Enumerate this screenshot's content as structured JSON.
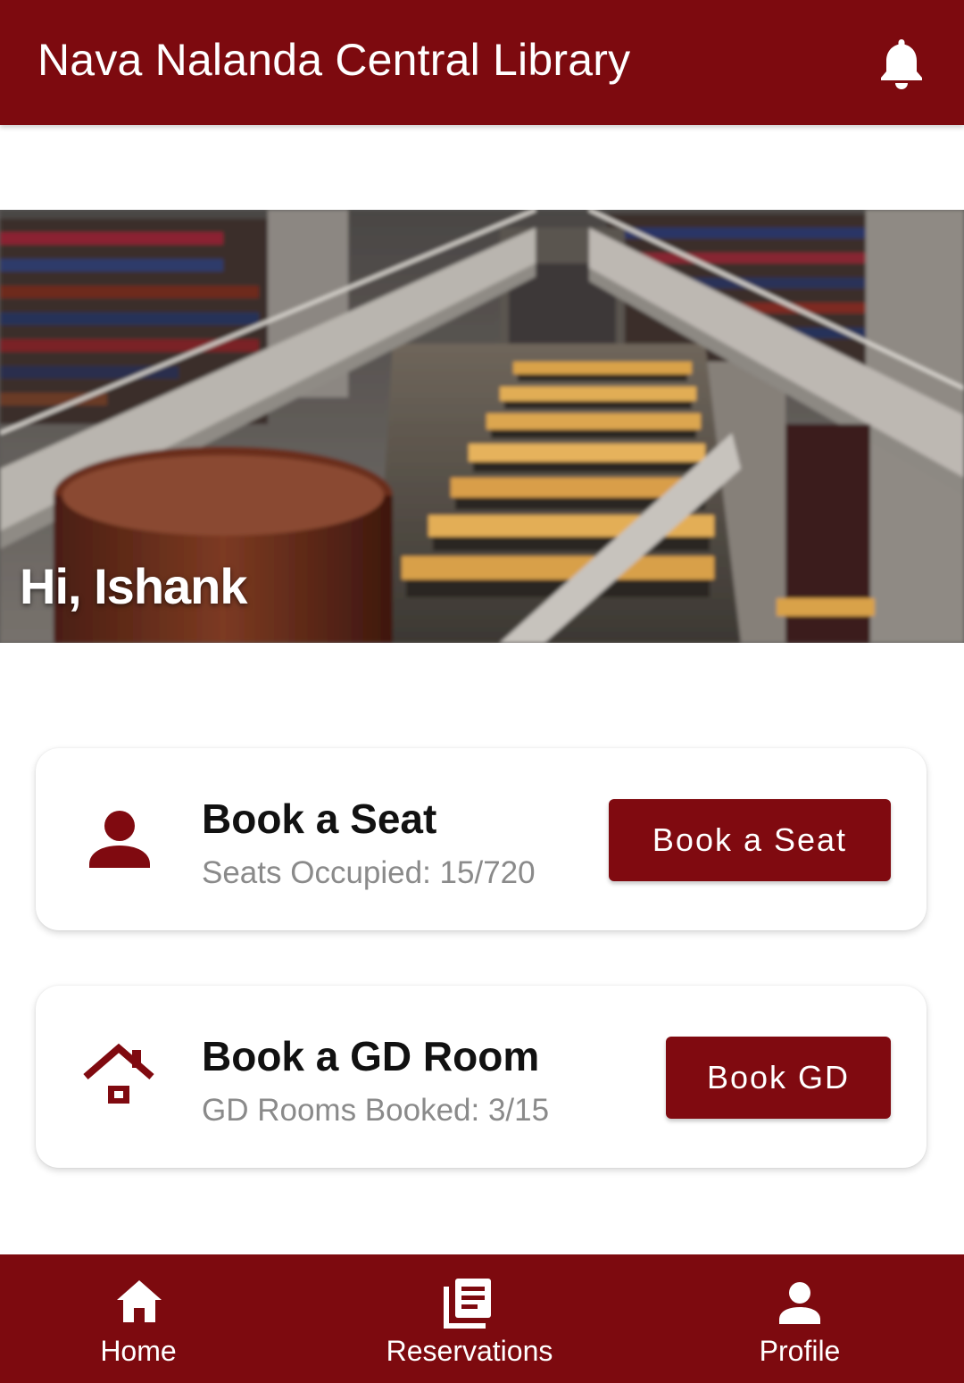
{
  "theme": {
    "primary": "#7d0a0f",
    "text": "#111111",
    "muted": "#8a8a8a"
  },
  "appbar": {
    "title": "Nava Nalanda Central Library",
    "icon": "bell-icon"
  },
  "hero": {
    "greeting": "Hi, Ishank"
  },
  "cards": [
    {
      "icon": "person-icon",
      "title": "Book a Seat",
      "subtitle": "Seats Occupied: 15/720",
      "button": "Book a Seat"
    },
    {
      "icon": "home-outline-icon",
      "title": "Book a GD Room",
      "subtitle": "GD Rooms Booked: 3/15",
      "button": "Book GD"
    }
  ],
  "bottom_nav": [
    {
      "label": "Home",
      "icon": "home-icon"
    },
    {
      "label": "Reservations",
      "icon": "reservations-icon"
    },
    {
      "label": "Profile",
      "icon": "profile-icon"
    }
  ]
}
